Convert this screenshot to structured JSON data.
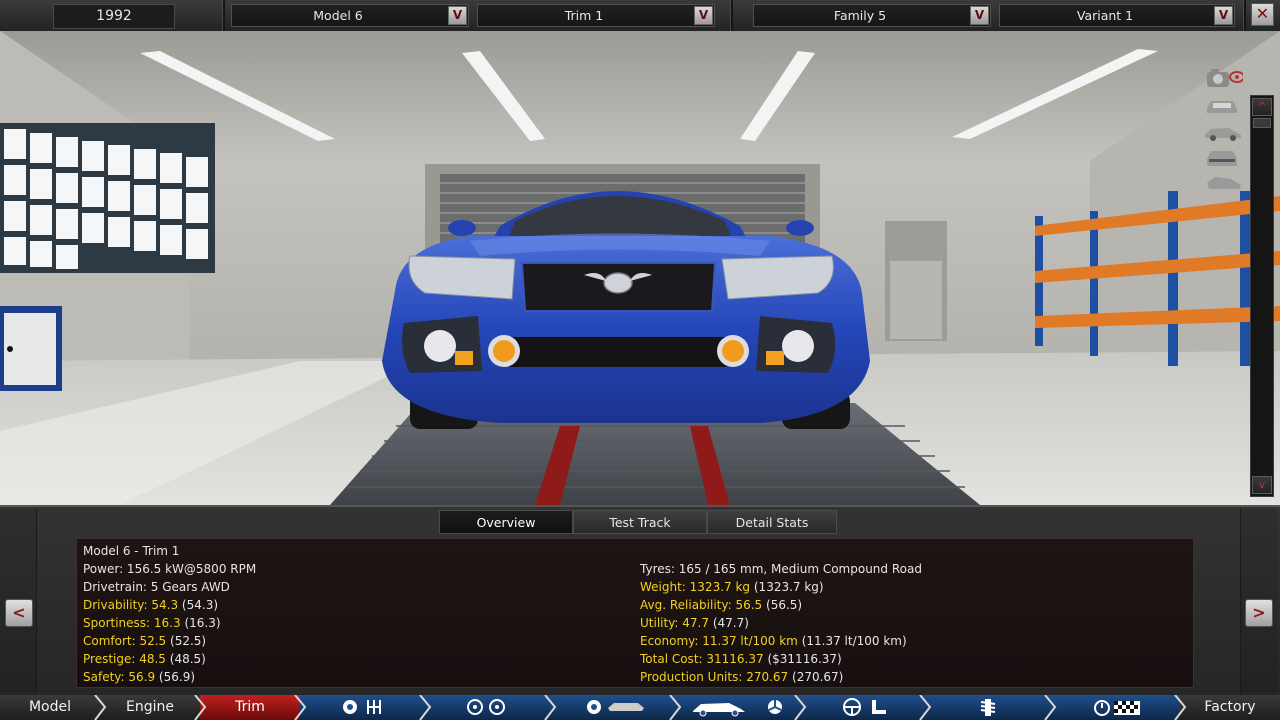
{
  "topbar": {
    "year": "1992",
    "model": "Model 6",
    "trim": "Trim 1",
    "family": "Family 5",
    "variant": "Variant 1",
    "dropdown_glyph": "V",
    "close_glyph": "✕"
  },
  "view_tools": {
    "icons": [
      "camera-icon",
      "eye-icon",
      "car-front-view-icon",
      "car-side-view-icon",
      "car-rear-view-icon",
      "car-angle-view-icon"
    ],
    "scroll_up": "^",
    "scroll_down": "v"
  },
  "panel": {
    "tabs": [
      {
        "label": "Overview",
        "active": true
      },
      {
        "label": "Test Track",
        "active": false
      },
      {
        "label": "Detail Stats",
        "active": false
      }
    ],
    "prev_glyph": "<",
    "next_glyph": ">",
    "stats_left": {
      "title": "Model 6 - Trim 1",
      "power": "Power: 156.5 kW@5800 RPM",
      "drivetrain": "Drivetrain: 5 Gears AWD",
      "drivability": {
        "label": "Drivability: 54.3",
        "ref": "(54.3)"
      },
      "sportiness": {
        "label": "Sportiness: 16.3",
        "ref": "(16.3)"
      },
      "comfort": {
        "label": "Comfort: 52.5",
        "ref": "(52.5)"
      },
      "prestige": {
        "label": "Prestige: 48.5",
        "ref": "(48.5)"
      },
      "safety": {
        "label": "Safety: 56.9",
        "ref": "(56.9)"
      }
    },
    "stats_right": {
      "tyres": "Tyres: 165 / 165 mm, Medium Compound Road",
      "weight": {
        "label": "Weight: 1323.7 kg",
        "ref": "(1323.7 kg)"
      },
      "reliability": {
        "label": "Avg. Reliability: 56.5",
        "ref": "(56.5)"
      },
      "utility": {
        "label": "Utility: 47.7",
        "ref": "(47.7)"
      },
      "economy": {
        "label": "Economy: 11.37 lt/100 km",
        "ref": "(11.37 lt/100 km)"
      },
      "total_cost": {
        "label": "Total Cost: 31116.37",
        "ref": "($31116.37)"
      },
      "production": {
        "label": "Production Units: 270.67",
        "ref": "(270.67)"
      }
    },
    "highlight_color": "#f0d11e"
  },
  "bottomnav": {
    "items": [
      {
        "label": "Model",
        "state": "dark"
      },
      {
        "label": "Engine",
        "state": "dark"
      },
      {
        "label": "Trim",
        "state": "active"
      },
      {
        "label": "",
        "icons": [
          "gear-icon",
          "gearbox-icon"
        ],
        "state": "blue"
      },
      {
        "label": "",
        "icons": [
          "wheel-icon",
          "wheel-icon"
        ],
        "state": "blue"
      },
      {
        "label": "",
        "icons": [
          "tyre-icon",
          "chassis-icon"
        ],
        "state": "blue"
      },
      {
        "label": "",
        "icons": [
          "car-body-icon",
          "fan-icon"
        ],
        "state": "blue"
      },
      {
        "label": "",
        "icons": [
          "steering-wheel-icon",
          "seat-icon"
        ],
        "state": "blue"
      },
      {
        "label": "",
        "icons": [
          "suspension-icon"
        ],
        "state": "blue"
      },
      {
        "label": "",
        "icons": [
          "stopwatch-icon",
          "checkered-flag-icon"
        ],
        "state": "blue"
      },
      {
        "label": "Factory",
        "state": "dark"
      }
    ],
    "active_color": "#c02020",
    "blue_color": "#1f4f8c"
  }
}
